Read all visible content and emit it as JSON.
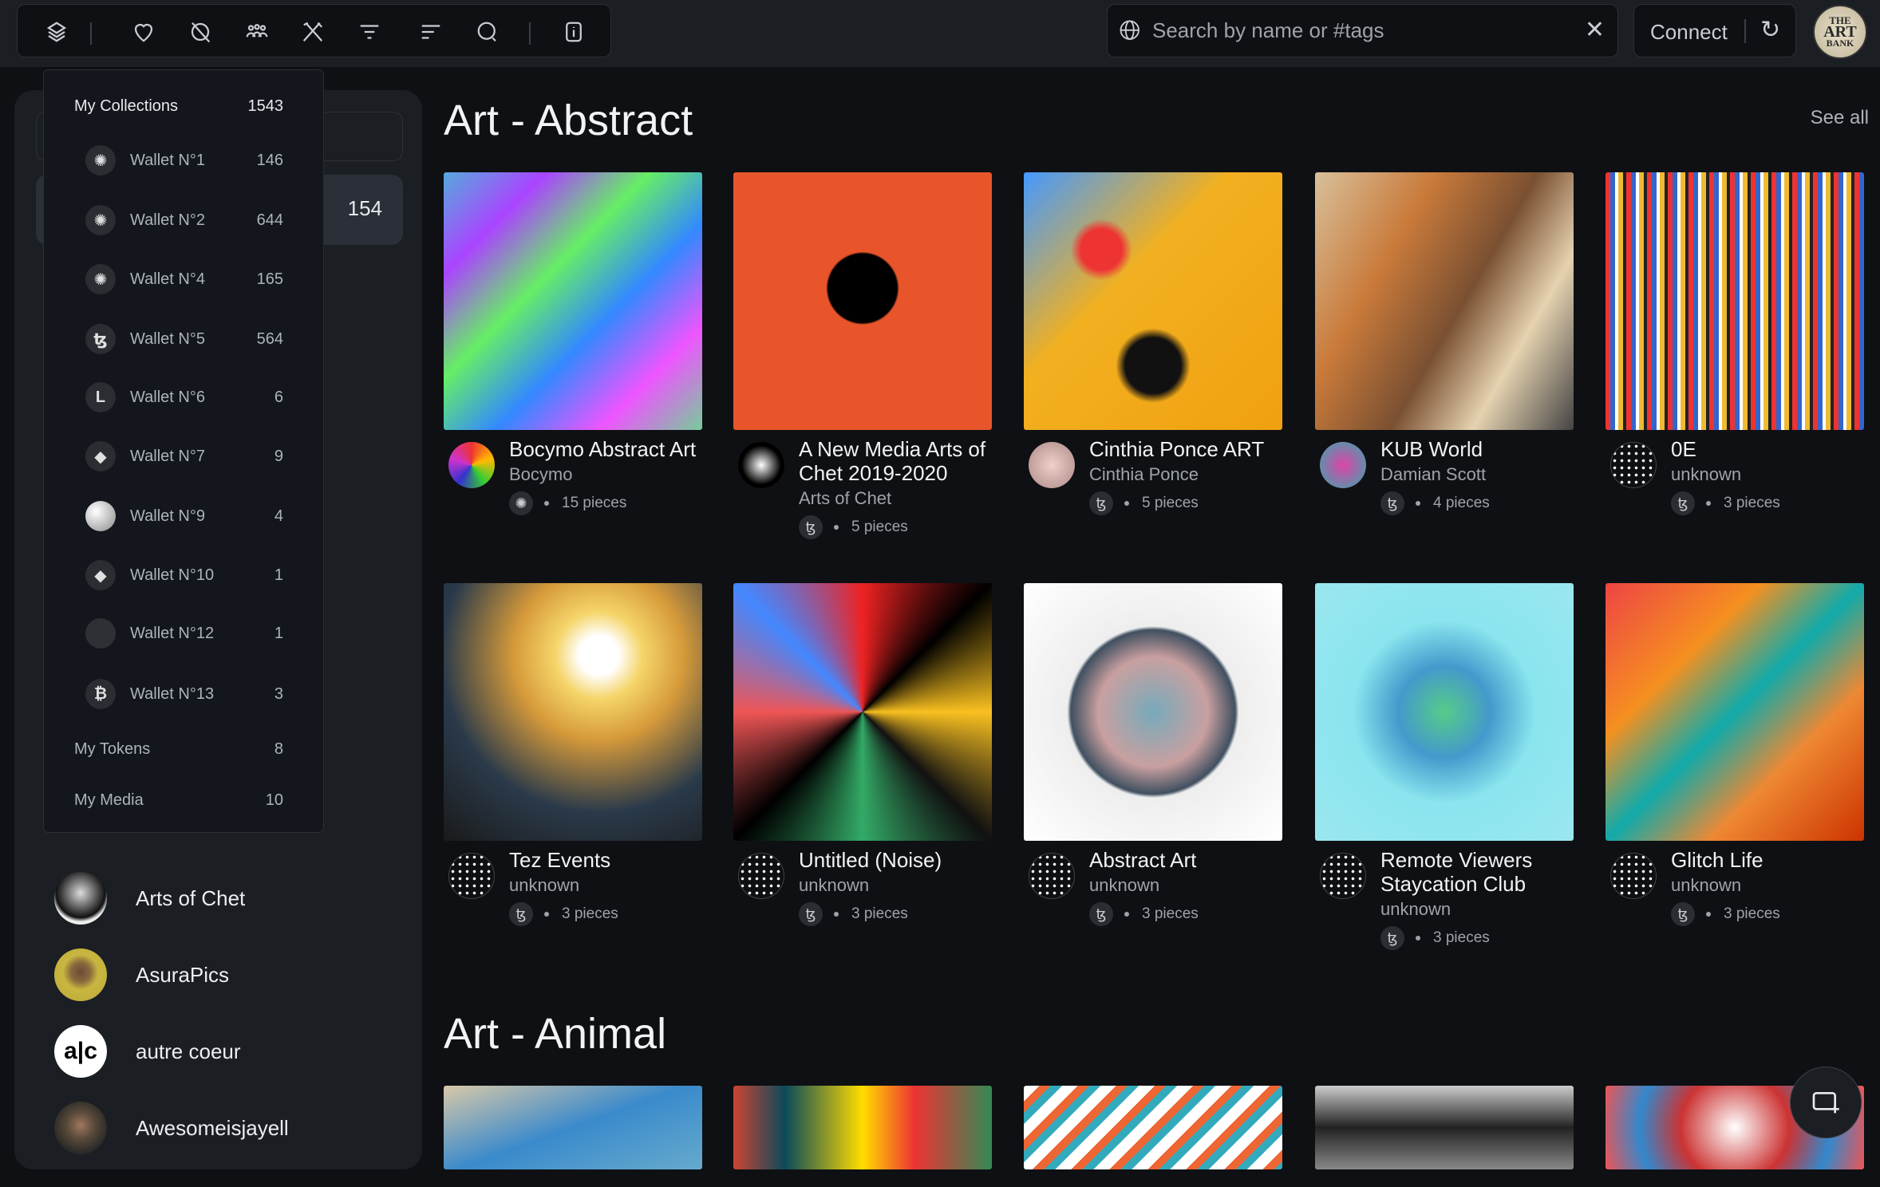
{
  "toolbar": {
    "icons": [
      "layers-icon",
      "heart-icon",
      "eye-off-icon",
      "users-icon",
      "tools-icon",
      "filter-icon",
      "sort-icon",
      "search-icon",
      "info-icon"
    ]
  },
  "search": {
    "placeholder": "Search by name or #tags",
    "value": ""
  },
  "connect": {
    "label": "Connect"
  },
  "brand": {
    "logo_text": "THE ART BANK"
  },
  "sidebar": {
    "selected_count": "154",
    "creators": [
      {
        "name": "Arts of Chet"
      },
      {
        "name": "AsuraPics"
      },
      {
        "name": "autre coeur"
      },
      {
        "name": "Awesomeisjayell"
      }
    ]
  },
  "dropdown": {
    "header": {
      "label": "My Collections",
      "count": "1543"
    },
    "wallets": [
      {
        "label": "Wallet N°1",
        "count": "146",
        "icon": "cardano-icon"
      },
      {
        "label": "Wallet N°2",
        "count": "644",
        "icon": "cardano-icon"
      },
      {
        "label": "Wallet N°4",
        "count": "165",
        "icon": "cardano-icon"
      },
      {
        "label": "Wallet N°5",
        "count": "564",
        "icon": "tezos-icon"
      },
      {
        "label": "Wallet N°6",
        "count": "6",
        "icon": "l-icon"
      },
      {
        "label": "Wallet N°7",
        "count": "9",
        "icon": "ethereum-icon"
      },
      {
        "label": "Wallet N°9",
        "count": "4",
        "icon": "sphere-icon"
      },
      {
        "label": "Wallet N°10",
        "count": "1",
        "icon": "ethereum-icon"
      },
      {
        "label": "Wallet N°12",
        "count": "1",
        "icon": "blank-icon"
      },
      {
        "label": "Wallet N°13",
        "count": "3",
        "icon": "bitcoin-icon"
      }
    ],
    "tokens": {
      "label": "My Tokens",
      "count": "8"
    },
    "media": {
      "label": "My Media",
      "count": "10"
    }
  },
  "sections": [
    {
      "title": "Art - Abstract",
      "see_all": "See all",
      "cards": [
        {
          "title": "Bocymo Abstract Art",
          "creator": "Bocymo",
          "chain": "cardano",
          "pieces": "15 pieces"
        },
        {
          "title": "A New Media Arts of Chet 2019-2020",
          "creator": "Arts of Chet",
          "chain": "tezos",
          "pieces": "5 pieces"
        },
        {
          "title": "Cinthia Ponce ART",
          "creator": "Cinthia Ponce",
          "chain": "tezos",
          "pieces": "5 pieces"
        },
        {
          "title": "KUB World",
          "creator": "Damian Scott",
          "chain": "tezos",
          "pieces": "4 pieces"
        },
        {
          "title": "0E",
          "creator": "unknown",
          "chain": "tezos",
          "pieces": "3 pieces"
        },
        {
          "title": "Tez Events",
          "creator": "unknown",
          "chain": "tezos",
          "pieces": "3 pieces"
        },
        {
          "title": "Untitled (Noise)",
          "creator": "unknown",
          "chain": "tezos",
          "pieces": "3 pieces"
        },
        {
          "title": "Abstract Art",
          "creator": "unknown",
          "chain": "tezos",
          "pieces": "3 pieces"
        },
        {
          "title": "Remote Viewers Staycation Club",
          "creator": "unknown",
          "chain": "tezos",
          "pieces": "3 pieces"
        },
        {
          "title": "Glitch Life",
          "creator": "unknown",
          "chain": "tezos",
          "pieces": "3 pieces"
        }
      ]
    },
    {
      "title": "Art - Animal"
    }
  ]
}
